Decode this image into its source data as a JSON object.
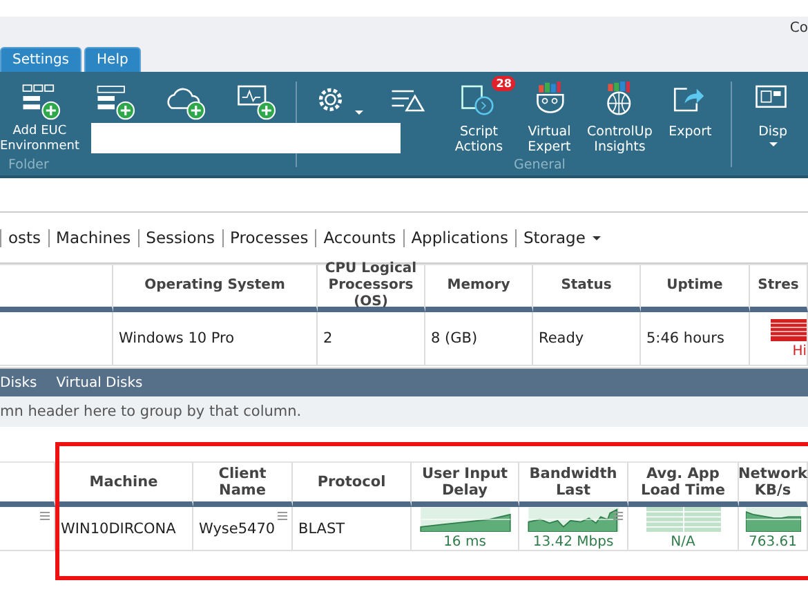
{
  "header_text": "Co",
  "menu_tabs": [
    {
      "label": "Settings"
    },
    {
      "label": "Help"
    }
  ],
  "ribbon": {
    "buttons": [
      {
        "label": "Add EUC Environment",
        "caret": false
      },
      {
        "caret": false
      },
      {
        "caret": false
      },
      {
        "caret": false
      },
      {
        "caret": true
      },
      {
        "caret": false
      },
      {
        "label": "Script Actions",
        "badge": "28",
        "caret": false
      },
      {
        "label": "Virtual Expert",
        "caret": false
      },
      {
        "label": "ControlUp Insights",
        "caret": false
      },
      {
        "label": "Export",
        "caret": false
      },
      {
        "label": "Disp",
        "caret": true
      }
    ],
    "groups": [
      "Folder",
      "General"
    ]
  },
  "nav": [
    {
      "label": "osts",
      "kind": "link"
    },
    {
      "label": "Machines",
      "kind": "link"
    },
    {
      "label": "Sessions",
      "kind": "link"
    },
    {
      "label": "Processes",
      "kind": "link"
    },
    {
      "label": "Accounts",
      "kind": "link"
    },
    {
      "label": "Applications",
      "kind": "link"
    },
    {
      "label": "Storage",
      "kind": "dropdown"
    }
  ],
  "machines_table": {
    "columns": [
      "",
      "Operating System",
      "CPU Logical Processors (OS)",
      "Memory",
      "Status",
      "Uptime",
      "Stres"
    ],
    "rows": [
      [
        {
          "text": ""
        },
        {
          "text": "Windows 10 Pro"
        },
        {
          "text": "2"
        },
        {
          "text": "8 (GB)"
        },
        {
          "text": "Ready"
        },
        {
          "text": "5:46 hours"
        },
        {
          "kind": "stress",
          "text": "Hi"
        }
      ]
    ]
  },
  "sub_tabs": [
    "Disks",
    "Virtual Disks"
  ],
  "group_hint": "mn header here to group by that column.",
  "sessions_table": {
    "columns": [
      "",
      "Machine",
      "Client Name",
      "Protocol",
      "User Input Delay",
      "Bandwidth Last",
      "Avg. App Load Time",
      "Network KB/s"
    ],
    "rows": [
      [
        {
          "text": "",
          "menu": true
        },
        {
          "text": "WIN10DIRCONA"
        },
        {
          "text": "Wyse5470",
          "menu": true
        },
        {
          "text": "BLAST"
        },
        {
          "kind": "spark",
          "text": "16 ms"
        },
        {
          "kind": "spark",
          "text": "13.42 Mbps",
          "menu": true
        },
        {
          "kind": "empty-chart",
          "text": "N/A"
        },
        {
          "kind": "spark",
          "text": "763.61"
        }
      ]
    ]
  }
}
